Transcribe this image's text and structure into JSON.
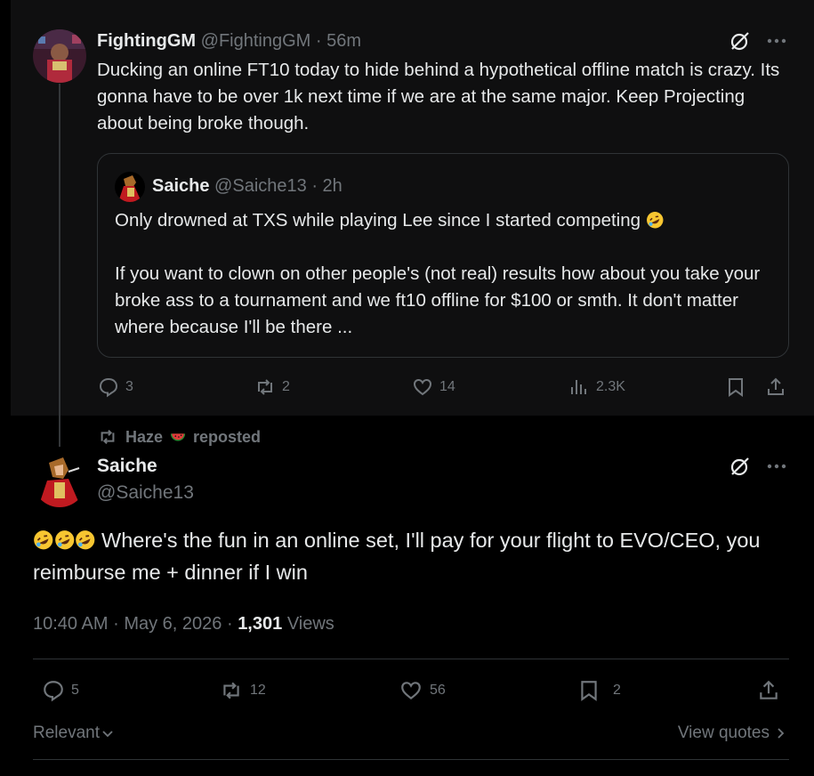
{
  "parent_tweet": {
    "display_name": "FightingGM",
    "handle": "@FightingGM",
    "separator": "·",
    "time": "56m",
    "text": "Ducking an online FT10 today to hide behind a hypothetical offline match is crazy. Its gonna have to be over 1k next time if we are at the same major. Keep Projecting about being broke though.",
    "quote": {
      "display_name": "Saiche",
      "handle": "@Saiche13",
      "separator": "·",
      "time": "2h",
      "text_line1": "Only drowned at TXS while playing Lee since I started competing",
      "text_line2": "If you want to clown on other people's (not real) results how about you take your broke ass to a tournament and we ft10 offline for $100 or smth. It don't matter where because I'll be there ..."
    },
    "actions": {
      "replies": "3",
      "reposts": "2",
      "likes": "14",
      "views": "2.3K"
    }
  },
  "repost_banner": {
    "user": "Haze",
    "label": "reposted"
  },
  "main_tweet": {
    "display_name": "Saiche",
    "handle": "@Saiche13",
    "text": "Where's the fun in an online set, I'll pay for your flight to EVO/CEO, you reimburse me + dinner if I win",
    "time": "10:40 AM",
    "date": "May 6, 2026",
    "separator": "·",
    "views_count": "1,301",
    "views_label": "Views",
    "actions": {
      "replies": "5",
      "reposts": "12",
      "likes": "56",
      "bookmarks": "2"
    }
  },
  "footer": {
    "sort_label": "Relevant",
    "view_quotes_label": "View quotes"
  },
  "colors": {
    "background": "#000000",
    "card": "#0f0f10",
    "text": "#e7e9ea",
    "muted": "#71767b",
    "border": "#2f3336"
  },
  "icons": [
    "reply-icon",
    "repost-icon",
    "like-icon",
    "views-icon",
    "bookmark-icon",
    "share-icon",
    "grok-icon",
    "more-icon",
    "chevron-down-icon",
    "chevron-right-icon",
    "rofl-emoji",
    "watermelon-emoji"
  ]
}
